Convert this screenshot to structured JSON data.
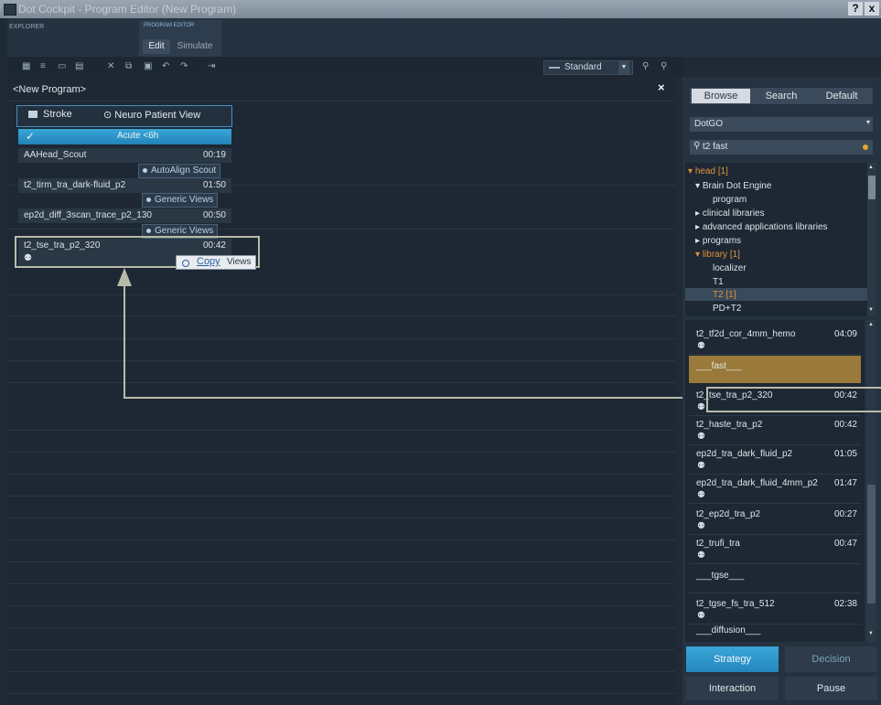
{
  "window": {
    "title": "Dot Cockpit - Program Editor (New Program)",
    "help_label": "?",
    "close_label": "x"
  },
  "topstrip": {
    "explorer_label": "EXPLORER",
    "program_editor_label": "PROGRAM EDITOR",
    "tabs": [
      {
        "label": "Edit"
      },
      {
        "label": "Simulate"
      }
    ]
  },
  "toolbar": {
    "view_select": "Standard",
    "icons": [
      "table-icon",
      "list-icon",
      "monitor-icon",
      "grid-icon",
      "delete-icon",
      "copy-icon",
      "paste-icon",
      "undo-icon",
      "redo-icon",
      "expand-icon",
      "zoom-in-icon",
      "zoom-out-icon"
    ]
  },
  "editor": {
    "program_name": "<New Program>",
    "close_glyph": "×",
    "views": {
      "stroke": "Stroke",
      "neuro_patient_view": "Neuro Patient View"
    },
    "strategy_header": {
      "check": "✓",
      "label": "Acute <6h"
    },
    "protocols": [
      {
        "name": "AAHead_Scout",
        "duration": "00:19",
        "action": "AutoAlign Scout"
      },
      {
        "name": "t2_tirm_tra_dark-fluid_p2",
        "duration": "01:50",
        "action": "Generic Views"
      },
      {
        "name": "ep2d_diff_3scan_trace_p2_130",
        "duration": "00:50",
        "action": "Generic Views"
      },
      {
        "name": "t2_tse_tra_p2_320",
        "duration": "00:42",
        "action": "Copy",
        "action_rest": "Views"
      }
    ],
    "patient_glyph": "⚉"
  },
  "browser": {
    "tabs": [
      {
        "label": "Browse"
      },
      {
        "label": "Search"
      },
      {
        "label": "Default"
      }
    ],
    "library_select": "DotGO",
    "search_query": "t2 fast",
    "tree": [
      {
        "label": "head [1]",
        "orange": true
      },
      {
        "label": "Brain Dot Engine"
      },
      {
        "label": "program"
      },
      {
        "label": "clinical libraries"
      },
      {
        "label": "advanced applications libraries"
      },
      {
        "label": "programs"
      },
      {
        "label": "library [1]",
        "orange": true
      },
      {
        "label": "localizer"
      },
      {
        "label": "T1"
      },
      {
        "label": "T2 [1]",
        "orange": true
      },
      {
        "label": "PD+T2"
      }
    ],
    "results": [
      {
        "name": "t2_tf2d_cor_4mm_hemo",
        "duration": "04:09"
      },
      {
        "name": "t2_tse_tra_p2_320",
        "duration": "00:42"
      },
      {
        "name": "t2_haste_tra_p2",
        "duration": "00:42"
      },
      {
        "name": "ep2d_tra_dark_fluid_p2",
        "duration": "01:05"
      },
      {
        "name": "ep2d_tra_dark_fluid_4mm_p2",
        "duration": "01:47"
      },
      {
        "name": "t2_ep2d_tra_p2",
        "duration": "00:27"
      },
      {
        "name": "t2_trufi_tra",
        "duration": "00:47"
      },
      {
        "name": "t2_tgse_fs_tra_512",
        "duration": "02:38"
      }
    ],
    "separators": {
      "fast": "___fast___",
      "tgse": "___tgse___",
      "diffusion": "___diffusion___"
    }
  },
  "actions": {
    "strategy": "Strategy",
    "decision": "Decision",
    "interaction": "Interaction",
    "pause": "Pause"
  },
  "colors": {
    "accent": "#2a9bd0",
    "highlight": "#e0923a",
    "callout": "#b9bba9"
  }
}
